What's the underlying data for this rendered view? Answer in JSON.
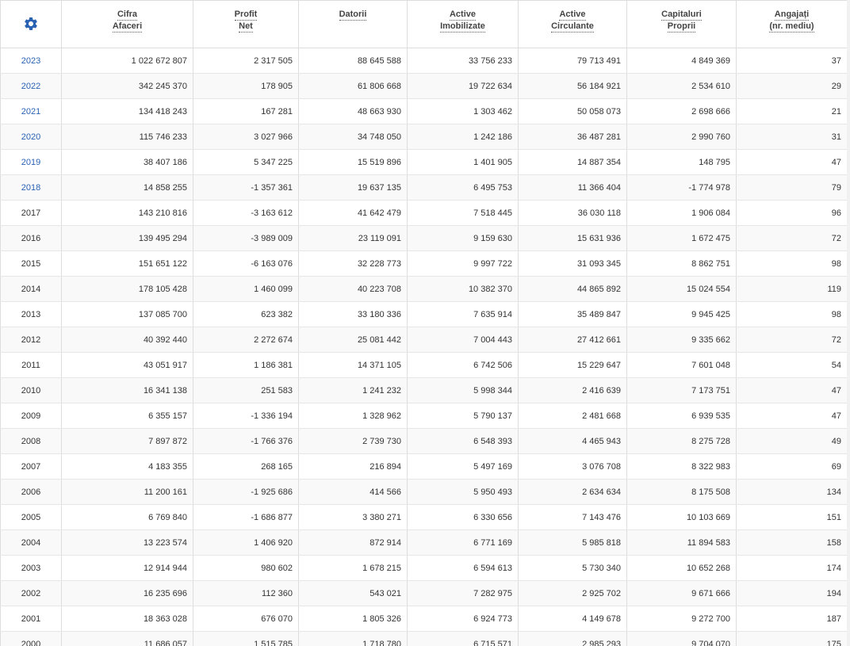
{
  "accent_color": "#2a62b3",
  "settings": {
    "icon": "gear-icon"
  },
  "columns": [
    {
      "line1": "Cifra",
      "line2": "Afaceri"
    },
    {
      "line1": "Profit",
      "line2": "Net"
    },
    {
      "line1": "Datorii",
      "line2": ""
    },
    {
      "line1": "Active",
      "line2": "Imobilizate"
    },
    {
      "line1": "Active",
      "line2": "Circulante"
    },
    {
      "line1": "Capitaluri",
      "line2": "Proprii"
    },
    {
      "line1": "Angajați",
      "line2": "(nr. mediu)"
    }
  ],
  "rows": [
    {
      "year": "2023",
      "link": true,
      "values": [
        "1 022 672 807",
        "2 317 505",
        "88 645 588",
        "33 756 233",
        "79 713 491",
        "4 849 369",
        "37"
      ]
    },
    {
      "year": "2022",
      "link": true,
      "values": [
        "342 245 370",
        "178 905",
        "61 806 668",
        "19 722 634",
        "56 184 921",
        "2 534 610",
        "29"
      ]
    },
    {
      "year": "2021",
      "link": true,
      "values": [
        "134 418 243",
        "167 281",
        "48 663 930",
        "1 303 462",
        "50 058 073",
        "2 698 666",
        "21"
      ]
    },
    {
      "year": "2020",
      "link": true,
      "values": [
        "115 746 233",
        "3 027 966",
        "34 748 050",
        "1 242 186",
        "36 487 281",
        "2 990 760",
        "31"
      ]
    },
    {
      "year": "2019",
      "link": true,
      "values": [
        "38 407 186",
        "5 347 225",
        "15 519 896",
        "1 401 905",
        "14 887 354",
        "148 795",
        "47"
      ]
    },
    {
      "year": "2018",
      "link": true,
      "values": [
        "14 858 255",
        "-1 357 361",
        "19 637 135",
        "6 495 753",
        "11 366 404",
        "-1 774 978",
        "79"
      ]
    },
    {
      "year": "2017",
      "link": false,
      "values": [
        "143 210 816",
        "-3 163 612",
        "41 642 479",
        "7 518 445",
        "36 030 118",
        "1 906 084",
        "96"
      ]
    },
    {
      "year": "2016",
      "link": false,
      "values": [
        "139 495 294",
        "-3 989 009",
        "23 119 091",
        "9 159 630",
        "15 631 936",
        "1 672 475",
        "72"
      ]
    },
    {
      "year": "2015",
      "link": false,
      "values": [
        "151 651 122",
        "-6 163 076",
        "32 228 773",
        "9 997 722",
        "31 093 345",
        "8 862 751",
        "98"
      ]
    },
    {
      "year": "2014",
      "link": false,
      "values": [
        "178 105 428",
        "1 460 099",
        "40 223 708",
        "10 382 370",
        "44 865 892",
        "15 024 554",
        "119"
      ]
    },
    {
      "year": "2013",
      "link": false,
      "values": [
        "137 085 700",
        "623 382",
        "33 180 336",
        "7 635 914",
        "35 489 847",
        "9 945 425",
        "98"
      ]
    },
    {
      "year": "2012",
      "link": false,
      "values": [
        "40 392 440",
        "2 272 674",
        "25 081 442",
        "7 004 443",
        "27 412 661",
        "9 335 662",
        "72"
      ]
    },
    {
      "year": "2011",
      "link": false,
      "values": [
        "43 051 917",
        "1 186 381",
        "14 371 105",
        "6 742 506",
        "15 229 647",
        "7 601 048",
        "54"
      ]
    },
    {
      "year": "2010",
      "link": false,
      "values": [
        "16 341 138",
        "251 583",
        "1 241 232",
        "5 998 344",
        "2 416 639",
        "7 173 751",
        "47"
      ]
    },
    {
      "year": "2009",
      "link": false,
      "values": [
        "6 355 157",
        "-1 336 194",
        "1 328 962",
        "5 790 137",
        "2 481 668",
        "6 939 535",
        "47"
      ]
    },
    {
      "year": "2008",
      "link": false,
      "values": [
        "7 897 872",
        "-1 766 376",
        "2 739 730",
        "6 548 393",
        "4 465 943",
        "8 275 728",
        "49"
      ]
    },
    {
      "year": "2007",
      "link": false,
      "values": [
        "4 183 355",
        "268 165",
        "216 894",
        "5 497 169",
        "3 076 708",
        "8 322 983",
        "69"
      ]
    },
    {
      "year": "2006",
      "link": false,
      "values": [
        "11 200 161",
        "-1 925 686",
        "414 566",
        "5 950 493",
        "2 634 634",
        "8 175 508",
        "134"
      ]
    },
    {
      "year": "2005",
      "link": false,
      "values": [
        "6 769 840",
        "-1 686 877",
        "3 380 271",
        "6 330 656",
        "7 143 476",
        "10 103 669",
        "151"
      ]
    },
    {
      "year": "2004",
      "link": false,
      "values": [
        "13 223 574",
        "1 406 920",
        "872 914",
        "6 771 169",
        "5 985 818",
        "11 894 583",
        "158"
      ]
    },
    {
      "year": "2003",
      "link": false,
      "values": [
        "12 914 944",
        "980 602",
        "1 678 215",
        "6 594 613",
        "5 730 340",
        "10 652 268",
        "174"
      ]
    },
    {
      "year": "2002",
      "link": false,
      "values": [
        "16 235 696",
        "112 360",
        "543 021",
        "7 282 975",
        "2 925 702",
        "9 671 666",
        "194"
      ]
    },
    {
      "year": "2001",
      "link": false,
      "values": [
        "18 363 028",
        "676 070",
        "1 805 326",
        "6 924 773",
        "4 149 678",
        "9 272 700",
        "187"
      ]
    },
    {
      "year": "2000",
      "link": false,
      "values": [
        "11 686 057",
        "1 515 785",
        "1 718 780",
        "6 715 571",
        "2 985 293",
        "9 704 070",
        "175"
      ]
    }
  ]
}
